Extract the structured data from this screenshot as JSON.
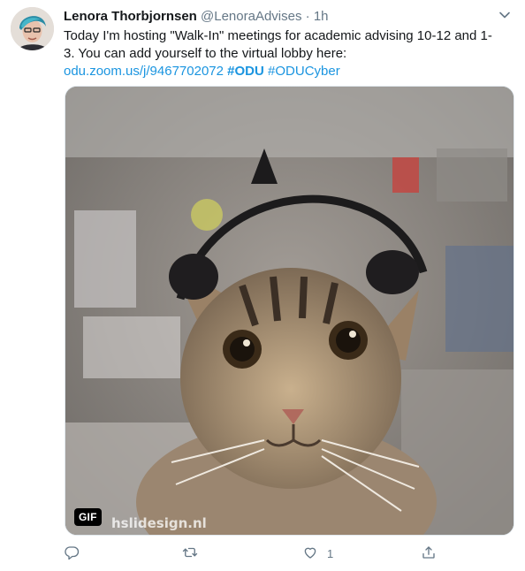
{
  "tweet": {
    "author_name": "Lenora Thorbjornsen",
    "author_handle": "@LenoraAdvises",
    "separator": "·",
    "timestamp": "1h",
    "text_line1": "Today I'm hosting \"Walk-In\" meetings for academic advising 10-12 and 1-",
    "text_line2": "3. You can add yourself to the virtual lobby here:",
    "link": "odu.zoom.us/j/9467702072",
    "hashtag1": "#ODU",
    "hashtag2": "#ODUCyber",
    "media_badge": "GIF",
    "media_watermark": "hslidesign.nl",
    "like_count": "1"
  },
  "icons": {
    "reply": "reply-icon",
    "retweet": "retweet-icon",
    "like": "heart-icon",
    "share": "share-icon",
    "menu": "chevron-down-icon"
  },
  "colors": {
    "link": "#1b95e0",
    "muted": "#657786",
    "text": "#14171a"
  }
}
